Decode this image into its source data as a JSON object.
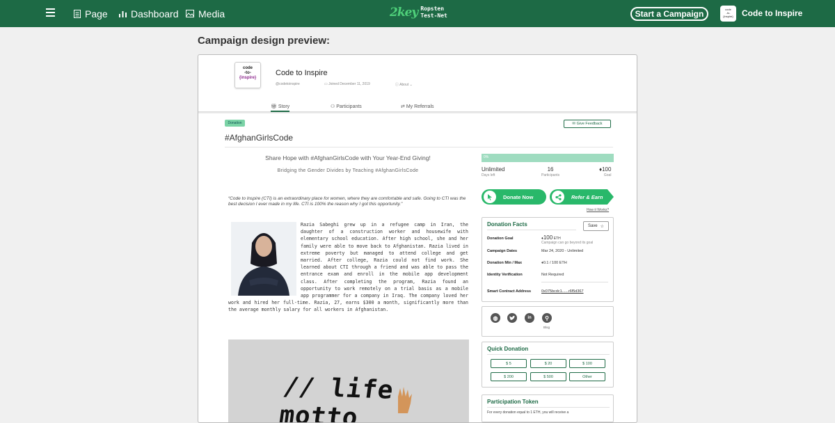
{
  "nav": {
    "page": "Page",
    "dashboard": "Dashboard",
    "media": "Media",
    "logo_mark": "2key",
    "logo_line1": "Ropsten",
    "logo_line2": "Test-Net",
    "start_campaign": "Start a Campaign",
    "profile_name": "Code to Inspire"
  },
  "preview_title": "Campaign design preview:",
  "org": {
    "avatar_line1": "code",
    "avatar_line2": "-to-",
    "avatar_line3": "{inspire}",
    "name": "Code to Inspire",
    "handle": "@codetoinspire",
    "joined": "Joined December 11, 2019",
    "about": "About"
  },
  "tabs": {
    "story": "Story",
    "participants": "Participants",
    "referrals": "My Referrals"
  },
  "badge": "Donation",
  "give_feedback": "Give Feedback",
  "campaign_title": "#AfghanGirlsCode",
  "headline": "Share Hope with #AfghanGirlsCode with Your Year-End Giving!",
  "subheadline": "Bridging the Gender Divides by Teaching #AfghanGirlsCode",
  "quote": "“Code to Inspire (CTI) is an extraordinary place for women, where they are comfortable and safe. Going to CTI was the best decision I ever made in my life. CTI is 100% the reason why I got this opportunity.”",
  "story": "Razia Sabeghi grew up in a refugee camp in Iran, the daughter of a construction worker and housewife with elementary school education. After high school, she and her family were able to move back to Afghanistan. Razia lived in extreme poverty but managed to attend college and get married. After college, Razia could not find work. She learned about CTI through a friend and was able to pass the entrance exam and enroll in the mobile app development class. After completing the program, Razia found an opportunity to work remotely on a trial basis as a mobile app programmer for a company in Iraq. The company loved her work and hired her full-time. Razia, 27, earns $300 a month, significantly more than the average monthly salary for all workers in Afghanistan.",
  "photo_caption": "// life motto",
  "progress": {
    "percent_label": "0%",
    "percent": 0
  },
  "stats": {
    "days_value": "Unlimited",
    "days_label": "Days left",
    "participants_value": "16",
    "participants_label": "Participants",
    "goal_value": "100",
    "goal_label": "Goal"
  },
  "donate_now": "Donate Now",
  "refer_earn": "Refer & Earn",
  "how_it_works": "How it Works?",
  "facts": {
    "title": "Donation Facts",
    "save": "Save",
    "goal_label": "Donation Goal",
    "goal_value": "100",
    "goal_unit": "ETH",
    "goal_note": "Campaign can go beyond its goal",
    "dates_label": "Campaign Dates",
    "dates_value": "Mar 24, 2020 - Unlimited",
    "minmax_label": "Donation Min / Max",
    "minmax_value": "0.1  /  100 ETH",
    "identity_label": "Identity Verification",
    "identity_value": "Not Required",
    "contract_label": "Smart Contract Address",
    "contract_value": "0x075bcdc1......r6f5d367"
  },
  "social": {
    "blog_label": "Blog"
  },
  "quick": {
    "title": "Quick Donation",
    "amounts": [
      "$ 5",
      "$ 20",
      "$ 100",
      "$ 200",
      "$ 500",
      "Other"
    ]
  },
  "token": {
    "title": "Participation Token",
    "text": "For every donation equal to 1 ETH, you will receive a"
  },
  "colors": {
    "brand": "#1d6a45",
    "accent": "#29b86a"
  }
}
